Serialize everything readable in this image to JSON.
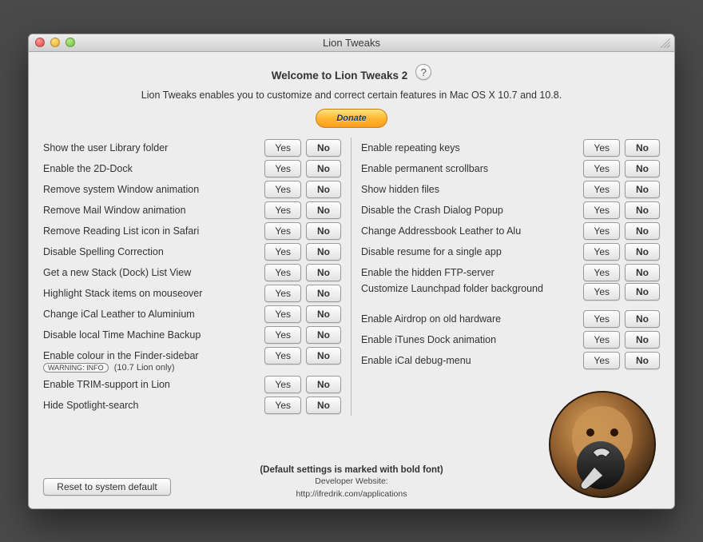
{
  "window_title": "Lion Tweaks",
  "headline": "Welcome to Lion Tweaks 2",
  "subtitle": "Lion Tweaks enables you to customize and correct certain features in Mac OS X 10.7 and 10.8.",
  "donate_label": "Donate",
  "yes": "Yes",
  "no": "No",
  "footnote": "(Default settings is marked with bold font)",
  "developer_line1": "Developer Website:",
  "developer_line2": "http://ifredrik.com/applications",
  "reset_label": "Reset to system default",
  "warning_pill": "WARNING: INFO",
  "warning_suffix": "(10.7 Lion only)",
  "left": [
    {
      "label": "Show the user Library folder"
    },
    {
      "label": "Enable the 2D-Dock"
    },
    {
      "label": "Remove system Window animation"
    },
    {
      "label": "Remove Mail Window animation"
    },
    {
      "label": "Remove Reading List icon in Safari"
    },
    {
      "label": "Disable Spelling Correction"
    },
    {
      "label": "Get a new Stack (Dock) List View"
    },
    {
      "label": "Highlight Stack items on mouseover"
    },
    {
      "label": "Change iCal Leather to Aluminium"
    },
    {
      "label": "Disable local Time Machine Backup"
    },
    {
      "label": "Enable colour in the Finder-sidebar",
      "warn": true
    },
    {
      "label": "Enable TRIM-support in Lion"
    },
    {
      "label": "Hide Spotlight-search"
    }
  ],
  "right": [
    {
      "label": "Enable repeating keys"
    },
    {
      "label": "Enable permanent scrollbars"
    },
    {
      "label": "Show hidden files"
    },
    {
      "label": "Disable the Crash Dialog Popup"
    },
    {
      "label": "Change Addressbook Leather to Alu"
    },
    {
      "label": "Disable resume for a single app"
    },
    {
      "label": "Enable the hidden FTP-server"
    },
    {
      "label": "Customize Launchpad folder background",
      "multiline": true
    },
    {
      "label": "Enable Airdrop on old hardware"
    },
    {
      "label": "Enable iTunes Dock animation"
    },
    {
      "label": "Enable iCal debug-menu"
    }
  ]
}
